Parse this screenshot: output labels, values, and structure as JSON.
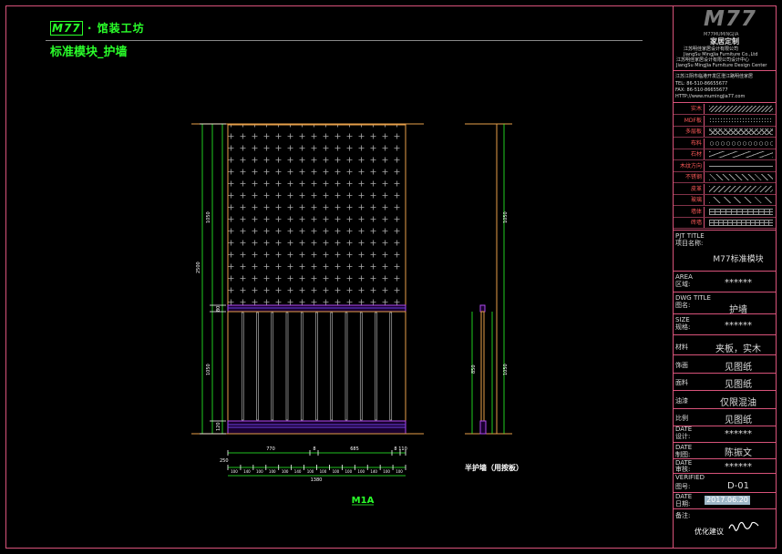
{
  "header": {
    "brand": "M77",
    "title_rest": "· 馆装工坊",
    "subtitle": "标准模块_护墙"
  },
  "drawing": {
    "elevation_label": "M1A",
    "section_label": "半护墙（用按板）",
    "dims_left": [
      "2500",
      "1050",
      "80",
      "1050",
      "120"
    ],
    "dims_top_under": [
      "770",
      "8",
      "685",
      "8",
      "110"
    ],
    "dims_small": [
      "100",
      "140",
      "100",
      "100",
      "100",
      "140",
      "100",
      "100",
      "100",
      "100",
      "100",
      "140",
      "100",
      "100"
    ],
    "dim_total": "1380",
    "dim_right_section": [
      "1050",
      "850",
      "1050"
    ]
  },
  "title_block": {
    "logo": "M77",
    "company_cn": "家居定制",
    "company_line1": "江苏明佳家居设计有限公司",
    "company_line2": "JiangSu MingJia Furniture Co.,Ltd",
    "company_line3": "江苏明佳家居设计有限公司设计中心",
    "company_line4": "JiangSu MingJia Furniture Design Center",
    "address": "江苏江阴市临港开发区澄江路明佳家居",
    "tel": "TEL: 86-510-86655677",
    "fax": "FAX: 86-510-86655677",
    "web": "HTTP://www.mumingjia77.com",
    "legend": [
      {
        "label": "实木",
        "pattern": "hatch"
      },
      {
        "label": "MDF板",
        "pattern": "dots"
      },
      {
        "label": "多层板",
        "pattern": "waves"
      },
      {
        "label": "布料",
        "pattern": "circles"
      },
      {
        "label": "石材",
        "pattern": "stone"
      },
      {
        "label": "木纹方向",
        "pattern": "arrow"
      },
      {
        "label": "不锈钢",
        "pattern": "diag"
      },
      {
        "label": "皮革",
        "pattern": "hatch2"
      },
      {
        "label": "玻璃",
        "pattern": "diag2"
      },
      {
        "label": "墙体",
        "pattern": "brick"
      },
      {
        "label": "砖墙",
        "pattern": "grid"
      }
    ],
    "prj_title_en": "PJT TITLE",
    "prj_title_cn": "项目名称:",
    "prj_value": "M77标准模块",
    "area_en": "AREA",
    "area_cn": "区域:",
    "area_value": "******",
    "dwg_title_en": "DWG TITLE",
    "dwg_title_cn": "图名:",
    "dwg_value": "护墙",
    "size_en": "SIZE",
    "size_cn": "规格:",
    "size_value": "******",
    "rows": [
      {
        "label": "材料",
        "value": "夹板，实木"
      },
      {
        "label": "饰面",
        "value": "见图纸"
      },
      {
        "label": "面料",
        "value": "见图纸"
      },
      {
        "label": "油漆",
        "value": "仅限混油"
      },
      {
        "label": "比例",
        "value": "见图纸"
      }
    ],
    "date1_en": "DATE",
    "date1_cn": "设计:",
    "date1_value": "******",
    "date2_en": "DATE",
    "date2_cn": "制图:",
    "date2_value": "陈振文",
    "date3_en": "DATE",
    "date3_cn": "审核:",
    "date3_value": "******",
    "verified": "VERIFIED",
    "sheet_cn": "图号:",
    "sheet_value": "D-01",
    "date4_en": "DATE",
    "date4_cn": "日期:",
    "date4_value": "2017.06.20",
    "remark_cn": "备注:",
    "remark_value": "优化建议"
  }
}
